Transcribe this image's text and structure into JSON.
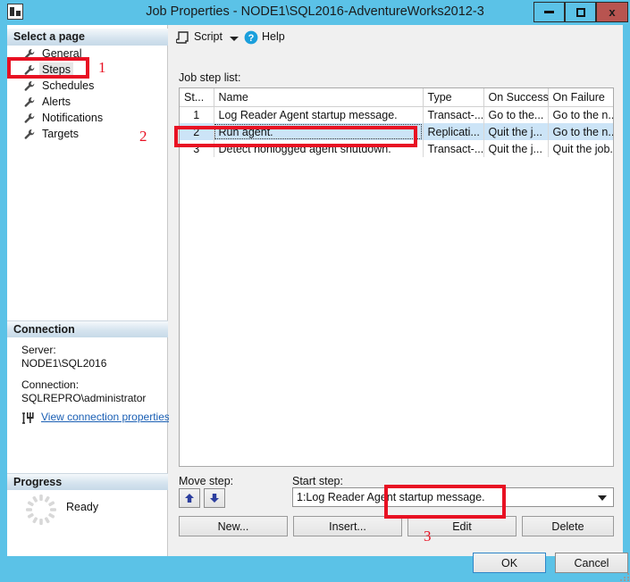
{
  "window": {
    "title": "Job Properties - NODE1\\SQL2016-AdventureWorks2012-3",
    "app_icon": "window-properties-icon",
    "minimize_label": "",
    "maximize_label": "",
    "close_label": "x",
    "titlebar_color": "#5bc2e7",
    "close_button_color": "#b85450"
  },
  "sidebar": {
    "select_page_header": "Select a page",
    "items": [
      {
        "label": "General",
        "icon": "wrench-icon",
        "selected": false
      },
      {
        "label": "Steps",
        "icon": "wrench-icon",
        "selected": true
      },
      {
        "label": "Schedules",
        "icon": "wrench-icon",
        "selected": false
      },
      {
        "label": "Alerts",
        "icon": "wrench-icon",
        "selected": false
      },
      {
        "label": "Notifications",
        "icon": "wrench-icon",
        "selected": false
      },
      {
        "label": "Targets",
        "icon": "wrench-icon",
        "selected": false
      }
    ],
    "connection": {
      "header": "Connection",
      "server_label": "Server:",
      "server_value": "NODE1\\SQL2016",
      "connection_label": "Connection:",
      "connection_value": "SQLREPRO\\administrator",
      "link_text": "View connection properties",
      "link_color": "#1a5fb4"
    },
    "progress": {
      "header": "Progress",
      "status": "Ready"
    }
  },
  "toolbar": {
    "script_label": "Script",
    "script_icon": "script-icon",
    "caret_icon": "chevron-down-icon",
    "help_label": "Help",
    "help_icon": "help-circle-icon"
  },
  "main": {
    "list_caption": "Job step list:",
    "columns": [
      "St...",
      "Name",
      "Type",
      "On Success",
      "On Failure"
    ],
    "rows": [
      {
        "step": "1",
        "name": "Log Reader Agent startup message.",
        "type": "Transact-...",
        "on_success": "Go to the...",
        "on_failure": "Go to the n...",
        "selected": false
      },
      {
        "step": "2",
        "name": "Run agent.",
        "type": "Replicati...",
        "on_success": "Quit the j...",
        "on_failure": "Go to the n...",
        "selected": true
      },
      {
        "step": "3",
        "name": "Detect nonlogged agent shutdown.",
        "type": "Transact-...",
        "on_success": "Quit the j...",
        "on_failure": "Quit the job...",
        "selected": false
      }
    ],
    "selection_color": "#cce4f7"
  },
  "controls": {
    "move_step_label": "Move step:",
    "move_up_icon": "arrow-up-icon",
    "move_down_icon": "arrow-down-icon",
    "start_step_label": "Start step:",
    "start_step_value": "1:Log Reader Agent startup message.",
    "new_label": "New...",
    "insert_label": "Insert...",
    "edit_label": "Edit",
    "delete_label": "Delete"
  },
  "footer": {
    "ok_label": "OK",
    "cancel_label": "Cancel"
  },
  "annotations": {
    "color": "#e81123",
    "markers": [
      {
        "number": "1",
        "target": "Steps sidebar item"
      },
      {
        "number": "2",
        "target": "Run agent. job step row"
      },
      {
        "number": "3",
        "target": "Edit button"
      }
    ]
  }
}
